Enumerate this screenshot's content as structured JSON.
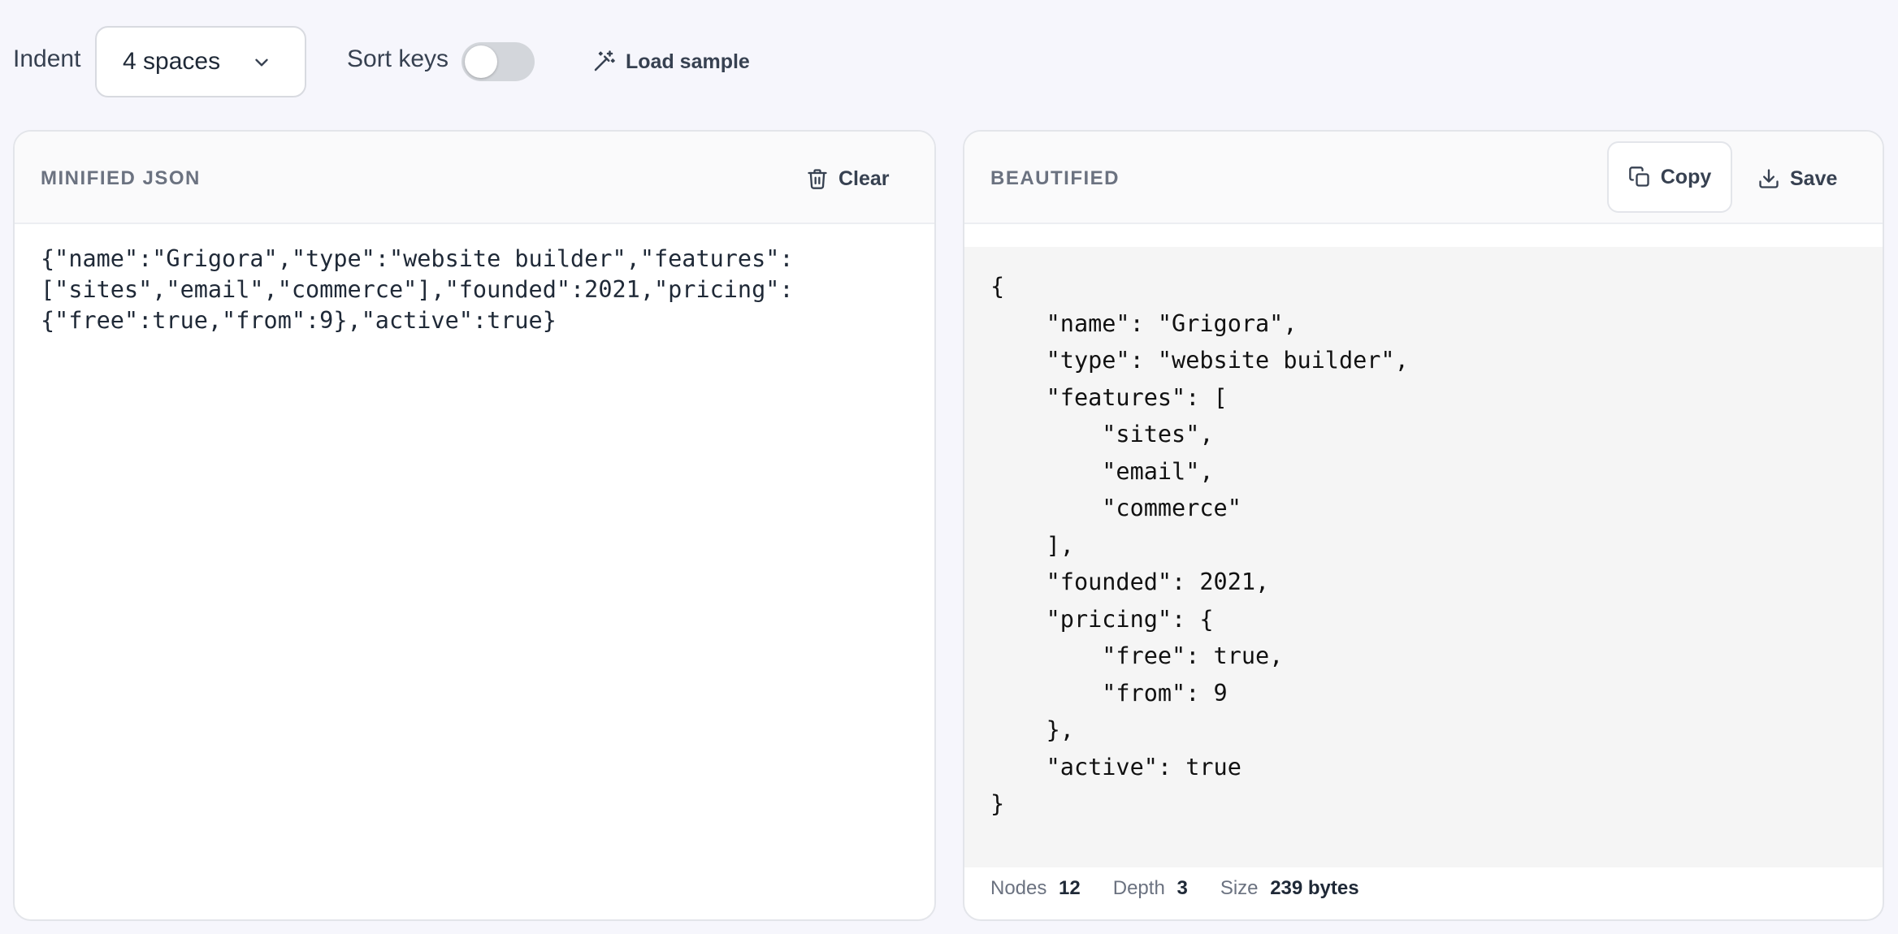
{
  "toolbar": {
    "indent_label": "Indent",
    "indent_value": "4 spaces",
    "sort_keys_label": "Sort keys",
    "sort_keys_enabled": false,
    "load_sample_label": "Load sample"
  },
  "input_panel": {
    "title": "MINIFIED JSON",
    "clear_label": "Clear",
    "text": "{\"name\":\"Grigora\",\"type\":\"website builder\",\"features\":\n[\"sites\",\"email\",\"commerce\"],\"founded\":2021,\"pricing\":\n{\"free\":true,\"from\":9},\"active\":true}"
  },
  "output_panel": {
    "title": "BEAUTIFIED",
    "copy_label": "Copy",
    "save_label": "Save",
    "text": "{\n    \"name\": \"Grigora\",\n    \"type\": \"website builder\",\n    \"features\": [\n        \"sites\",\n        \"email\",\n        \"commerce\"\n    ],\n    \"founded\": 2021,\n    \"pricing\": {\n        \"free\": true,\n        \"from\": 9\n    },\n    \"active\": true\n}"
  },
  "stats": {
    "nodes_label": "Nodes",
    "nodes_value": "12",
    "depth_label": "Depth",
    "depth_value": "3",
    "size_label": "Size",
    "size_value": "239 bytes"
  },
  "icons": {
    "indent_dropdown": "chevron-down-icon",
    "load_sample": "magic-wand-icon",
    "clear": "trash-icon",
    "copy": "copy-icon",
    "save": "download-icon"
  },
  "colors": {
    "background": "#f6f6fc",
    "panel": "#ffffff",
    "code_background": "#f5f5f5",
    "border": "#e3e5ea",
    "muted_text": "#6b7280",
    "toggle_off": "#d3d6db"
  }
}
